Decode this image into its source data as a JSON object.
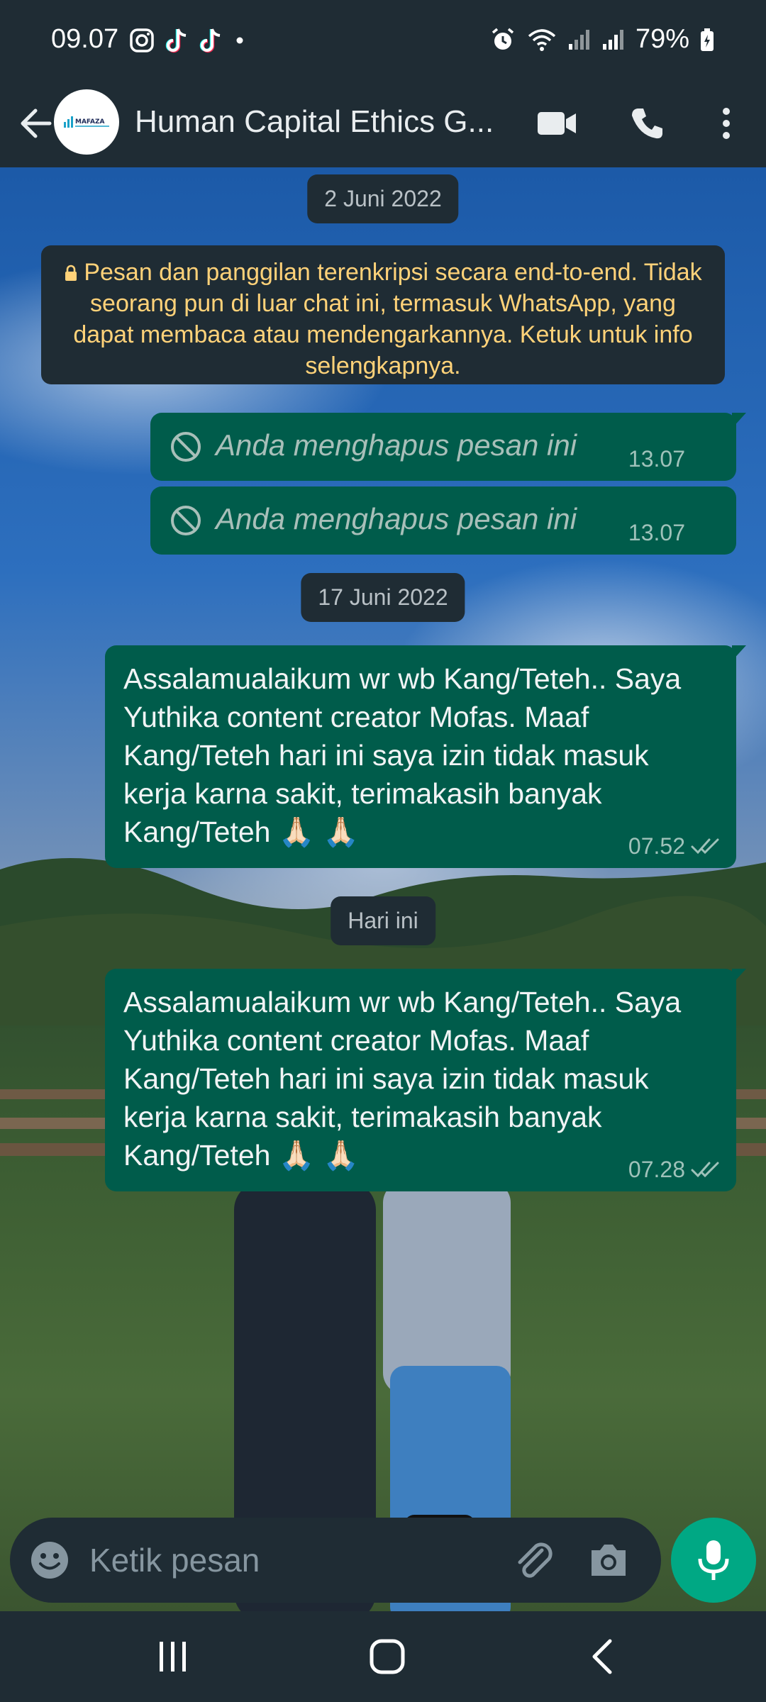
{
  "status_bar": {
    "time": "09.07",
    "battery": "79%",
    "icons": [
      "instagram-icon",
      "tiktok-icon",
      "tiktok-icon",
      "dot-icon",
      "alarm-icon",
      "wifi-icon",
      "signal-icon",
      "signal-icon",
      "battery-icon"
    ]
  },
  "header": {
    "title": "Human Capital Ethics G...",
    "avatar_text": "MAFAZA",
    "icons": [
      "back-arrow-icon",
      "video-call-icon",
      "phone-icon",
      "more-vert-icon"
    ]
  },
  "chat": {
    "date_chip_1": "2 Juni 2022",
    "encryption_notice": "Pesan dan panggilan terenkripsi secara end-to-end. Tidak seorang pun di luar chat ini, termasuk WhatsApp, yang dapat membaca atau mendengarkannya. Ketuk untuk info selengkapnya.",
    "deleted_messages": [
      {
        "text": "Anda menghapus pesan ini",
        "time": "13.07"
      },
      {
        "text": "Anda menghapus pesan ini",
        "time": "13.07"
      }
    ],
    "date_chip_2": "17 Juni 2022",
    "messages": [
      {
        "text": "Assalamualaikum wr wb Kang/Teteh.. Saya Yuthika content creator Mofas. Maaf Kang/Teteh hari ini saya izin tidak masuk kerja karna sakit, terimakasih banyak Kang/Teteh 🙏🏻 🙏🏻",
        "time": "07.52"
      },
      {
        "text": "Assalamualaikum wr wb Kang/Teteh.. Saya Yuthika content creator Mofas. Maaf Kang/Teteh hari ini saya izin tidak masuk kerja karna sakit, terimakasih banyak Kang/Teteh 🙏🏻 🙏🏻",
        "time": "07.28"
      }
    ],
    "date_chip_3": "Hari ini"
  },
  "input": {
    "placeholder": "Ketik pesan"
  },
  "colors": {
    "bar_bg": "#1f2c34",
    "bubble_out": "#005c4b",
    "accent": "#00a884",
    "notice_text": "#ffd279"
  }
}
